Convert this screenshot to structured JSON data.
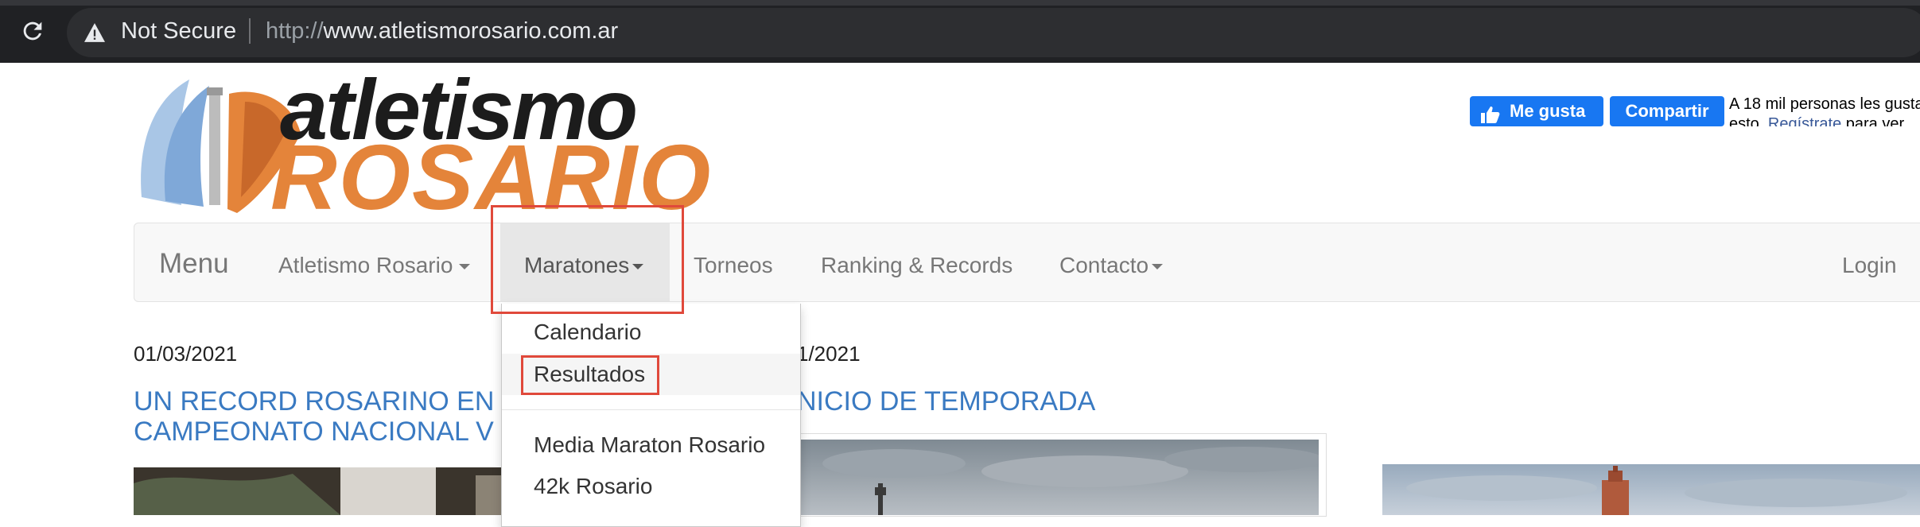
{
  "browser": {
    "security_label": "Not Secure",
    "url_scheme": "http://",
    "url_host": "www.atletismorosario.com.ar"
  },
  "logo": {
    "line1": "atletismo",
    "line2": "ROSARIO"
  },
  "facebook": {
    "like_label": "Me gusta",
    "share_label": "Compartir",
    "social_text_line1": "A 18 mil personas les gusta",
    "social_text_line2_pre": "esto.",
    "social_text_link": "Regístrate",
    "social_text_line2_post": "para ver"
  },
  "navbar": {
    "brand": "Menu",
    "items": [
      {
        "label": "Atletismo Rosario"
      },
      {
        "label": "Maratones"
      },
      {
        "label": "Torneos"
      },
      {
        "label": "Ranking & Records"
      },
      {
        "label": "Contacto"
      }
    ],
    "login": "Login"
  },
  "dropdown": {
    "items": [
      {
        "label": "Calendario"
      },
      {
        "label": "Resultados"
      },
      {
        "label": "Media Maraton Rosario"
      },
      {
        "label": "42k Rosario"
      }
    ]
  },
  "posts": [
    {
      "date": "01/03/2021",
      "title_line1": "UN RECORD ROSARINO EN",
      "title_line2": "CAMPEONATO NACIONAL V"
    },
    {
      "date": "1/2021",
      "title": "NICIO DE TEMPORADA"
    }
  ],
  "colors": {
    "link": "#3a7ac2",
    "highlight": "#e0493b",
    "facebook": "#1877f2",
    "logo_orange": "#e4843a"
  }
}
